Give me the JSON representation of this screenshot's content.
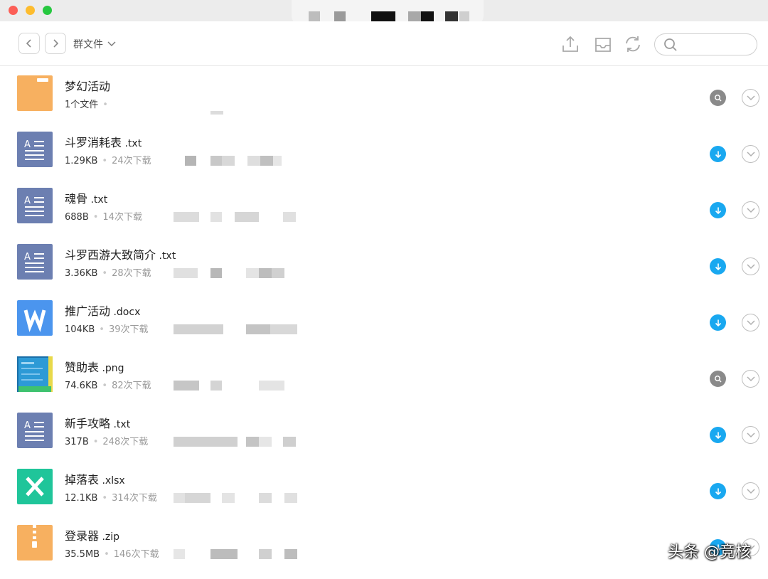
{
  "toolbar": {
    "back_label": "‹",
    "forward_label": "›",
    "folder_name": "群文件",
    "search_placeholder": ""
  },
  "colors": {
    "download": "#19a8f0",
    "preview": "#8a8a8a",
    "folder": "#f7b060",
    "txt": "#6c7fb1",
    "docx": "#4b95ee",
    "xlsx": "#1fc59a",
    "zip": "#f7b060"
  },
  "files": [
    {
      "name": "梦幻活动",
      "ext": "",
      "type": "folder",
      "icon": "folder-icon",
      "size": "1个文件",
      "downloads": "",
      "action": "preview"
    },
    {
      "name": "斗罗消耗表",
      "ext": " .txt",
      "type": "txt",
      "icon": "text-file-icon",
      "size": "1.29KB",
      "downloads": "24次下载",
      "action": "download"
    },
    {
      "name": "魂骨",
      "ext": " .txt",
      "type": "txt",
      "icon": "text-file-icon",
      "size": "688B",
      "downloads": "14次下载",
      "action": "download"
    },
    {
      "name": "斗罗西游大致简介",
      "ext": " .txt",
      "type": "txt",
      "icon": "text-file-icon",
      "size": "3.36KB",
      "downloads": "28次下载",
      "action": "download"
    },
    {
      "name": "推广活动",
      "ext": " .docx",
      "type": "docx",
      "icon": "word-file-icon",
      "size": "104KB",
      "downloads": "39次下载",
      "action": "download"
    },
    {
      "name": "赞助表",
      "ext": " .png",
      "type": "png",
      "icon": "image-thumbnail-icon",
      "size": "74.6KB",
      "downloads": "82次下载",
      "action": "preview"
    },
    {
      "name": "新手攻略",
      "ext": " .txt",
      "type": "txt",
      "icon": "text-file-icon",
      "size": "317B",
      "downloads": "248次下载",
      "action": "download"
    },
    {
      "name": "掉落表",
      "ext": " .xlsx",
      "type": "xlsx",
      "icon": "excel-file-icon",
      "size": "12.1KB",
      "downloads": "314次下载",
      "action": "download"
    },
    {
      "name": "登录器",
      "ext": " .zip",
      "type": "zip",
      "icon": "zip-file-icon",
      "size": "35.5MB",
      "downloads": "146次下载",
      "action": "download"
    }
  ],
  "watermark": "头条 @竞核"
}
